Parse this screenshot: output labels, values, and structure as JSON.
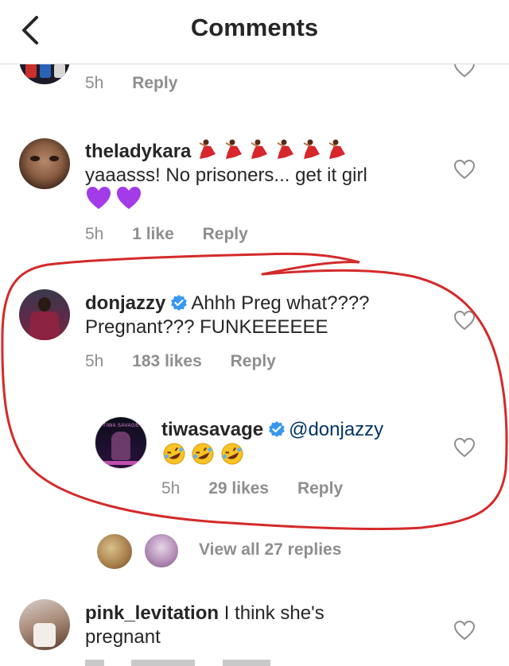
{
  "header": {
    "title": "Comments"
  },
  "partial_comment": {
    "time": "5h",
    "reply": "Reply"
  },
  "comments": [
    {
      "username": "theladykara",
      "text": "yaaasss! No prisoners... get it girl",
      "time": "5h",
      "likes": "1 like",
      "reply": "Reply"
    },
    {
      "username": "donjazzy",
      "text_line1": "Ahhh Preg what????",
      "text_line2": "Pregnant??? FUNKEEEEEE",
      "time": "5h",
      "likes": "183 likes",
      "reply": "Reply",
      "verified": true
    },
    {
      "username": "tiwasavage",
      "mention": "@donjazzy",
      "time": "5h",
      "likes": "29 likes",
      "reply": "Reply",
      "verified": true,
      "avatar_text": "TIWA SAVAGE"
    }
  ],
  "view_replies": {
    "label": "View all 27 replies"
  },
  "last_comment": {
    "username": "pink_levitation",
    "text_line1": "I think she's",
    "text_line2": "pregnant"
  },
  "colors": {
    "link_blue": "#003569",
    "meta_gray": "#8e8e8e",
    "verified_blue": "#3897f0",
    "annotation_red": "#d42a2a"
  },
  "icons": [
    "chevron-left-icon",
    "heart-icon",
    "verified-badge-icon",
    "dancer-emoji",
    "purple-heart-emoji",
    "rofl-emoji"
  ]
}
